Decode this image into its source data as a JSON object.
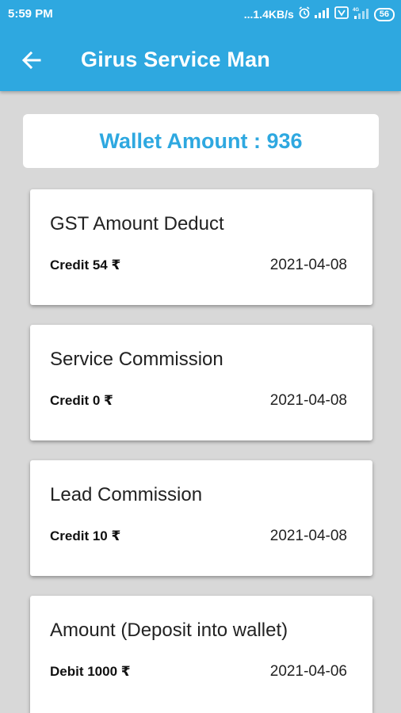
{
  "status_bar": {
    "time": "5:59 PM",
    "network_speed": "...1.4KB/s",
    "battery_level": "56",
    "icons": [
      "alarm-icon",
      "signal-icon",
      "volte-icon",
      "signal-4g-icon"
    ]
  },
  "app_bar": {
    "title": "Girus Service Man",
    "back_icon": "arrow-left-icon",
    "color": "#2ea8e0"
  },
  "wallet": {
    "label": "Wallet Amount : 936",
    "color": "#2ea8e0"
  },
  "transactions": [
    {
      "title": "GST Amount Deduct",
      "amount": "Credit 54 ₹",
      "date": "2021-04-08"
    },
    {
      "title": "Service Commission",
      "amount": "Credit 0 ₹",
      "date": "2021-04-08"
    },
    {
      "title": "Lead Commission",
      "amount": "Credit 10 ₹",
      "date": "2021-04-08"
    },
    {
      "title": "Amount (Deposit into wallet)",
      "amount": "Debit 1000 ₹",
      "date": "2021-04-06"
    }
  ]
}
